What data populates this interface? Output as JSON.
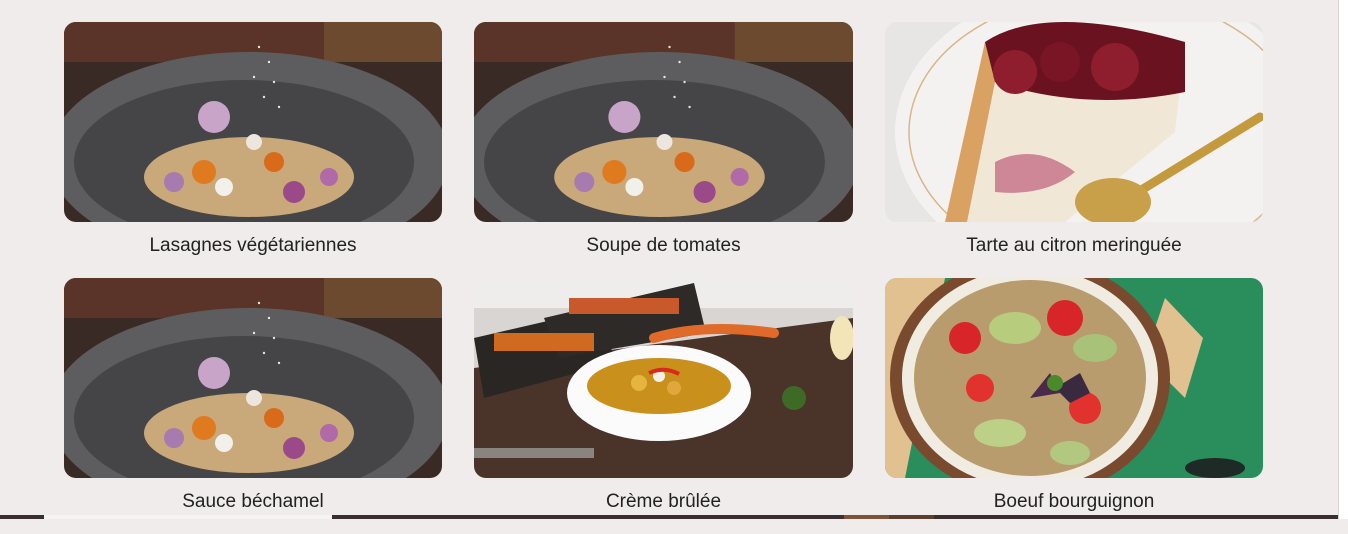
{
  "recipes": [
    {
      "title": "Lasagnes végétariennes",
      "image": "mortar-bowl-photo"
    },
    {
      "title": "Soupe de tomates",
      "image": "mortar-bowl-photo"
    },
    {
      "title": "Tarte au citron meringuée",
      "image": "cheesecake-slice-photo"
    },
    {
      "title": "Sauce béchamel",
      "image": "mortar-bowl-photo"
    },
    {
      "title": "Crème brûlée",
      "image": "curry-bowl-board-photo"
    },
    {
      "title": "Boeuf bourguignon",
      "image": "salad-bowl-photo"
    }
  ],
  "colors": {
    "background": "#f0eceb",
    "text": "#222222"
  }
}
